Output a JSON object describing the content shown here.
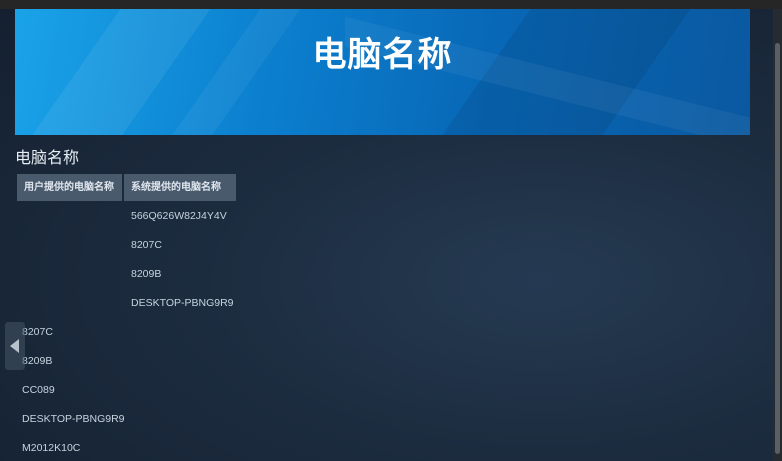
{
  "banner": {
    "title": "电脑名称"
  },
  "section": {
    "title": "电脑名称"
  },
  "table": {
    "headers": [
      "用户提供的电脑名称",
      "系统提供的电脑名称"
    ],
    "system_names": [
      "566Q626W82J4Y4V",
      "8207C",
      "8209B",
      "DESKTOP-PBNG9R9"
    ],
    "user_names": [
      "8207C",
      "8209B",
      "CC089",
      "DESKTOP-PBNG9R9",
      "M2012K10C"
    ]
  },
  "icons": {
    "side_arrow": "chevron-left-icon"
  }
}
